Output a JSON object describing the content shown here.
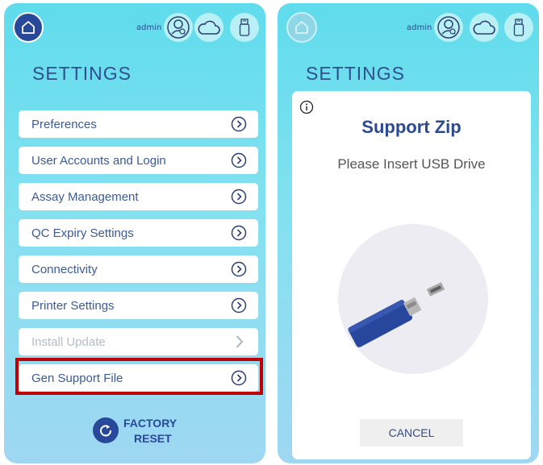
{
  "colors": {
    "accent": "#28489a",
    "highlight": "#c00000",
    "disabled_text": "#b5bcc8"
  },
  "header": {
    "user": "admin"
  },
  "left": {
    "title": "SETTINGS",
    "menu": [
      {
        "label": "Preferences"
      },
      {
        "label": "User Accounts and Login"
      },
      {
        "label": "Assay Management"
      },
      {
        "label": "QC Expiry Settings"
      },
      {
        "label": "Connectivity"
      },
      {
        "label": "Printer Settings"
      },
      {
        "label": "Install Update"
      },
      {
        "label": "Gen Support File"
      }
    ],
    "factory_reset": {
      "line1": "FACTORY",
      "line2": "RESET"
    }
  },
  "right": {
    "title": "SETTINGS",
    "dialog": {
      "title": "Support Zip",
      "message": "Please Insert USB Drive",
      "cancel": "CANCEL"
    }
  }
}
